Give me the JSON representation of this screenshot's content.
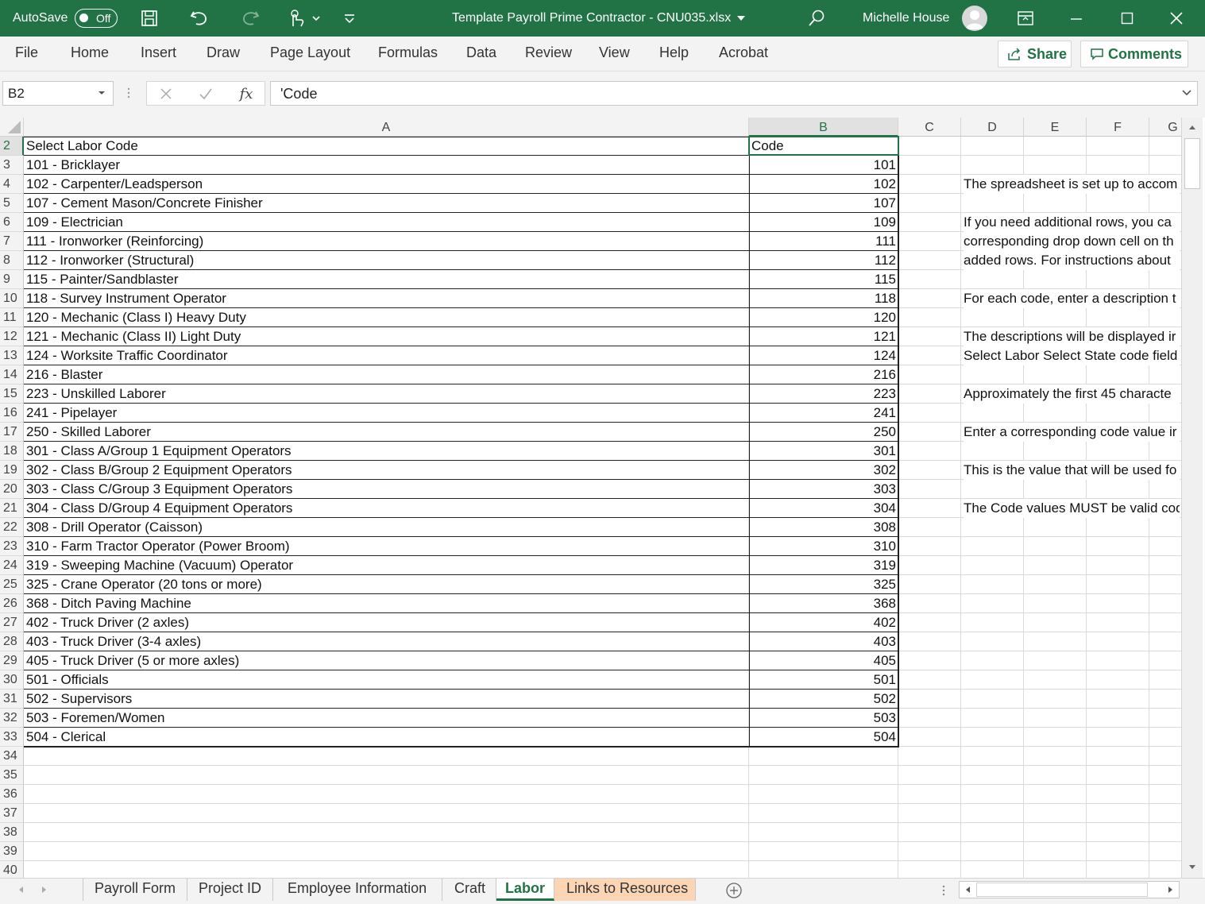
{
  "titlebar": {
    "autosave_label": "AutoSave",
    "autosave_state": "Off",
    "document_title": "Template Payroll Prime Contractor - CNU035.xlsx",
    "user_name": "Michelle House"
  },
  "ribbon": {
    "tabs": [
      "File",
      "Home",
      "Insert",
      "Draw",
      "Page Layout",
      "Formulas",
      "Data",
      "Review",
      "View",
      "Help",
      "Acrobat"
    ],
    "share_label": "Share",
    "comments_label": "Comments"
  },
  "formula_bar": {
    "name_box": "B2",
    "fx_label": "fx",
    "content": "'Code"
  },
  "grid": {
    "columns": [
      "A",
      "B",
      "C",
      "D",
      "E",
      "F",
      "G"
    ],
    "rows": [
      "2",
      "3",
      "4",
      "5",
      "6",
      "7",
      "8",
      "9",
      "10",
      "11",
      "12",
      "13",
      "14",
      "15",
      "16",
      "17",
      "18",
      "19",
      "20",
      "21",
      "22",
      "23",
      "24",
      "25",
      "26",
      "27",
      "28",
      "29",
      "30",
      "31",
      "32",
      "33",
      "34",
      "35",
      "36",
      "37",
      "38",
      "39",
      "40"
    ],
    "header_a": "Select Labor Code",
    "header_b": "Code",
    "labor_rows": [
      {
        "desc": "101 - Bricklayer",
        "code": "101"
      },
      {
        "desc": "102 - Carpenter/Leadsperson",
        "code": "102"
      },
      {
        "desc": "107 - Cement Mason/Concrete Finisher",
        "code": "107"
      },
      {
        "desc": "109 - Electrician",
        "code": "109"
      },
      {
        "desc": "111 - Ironworker (Reinforcing)",
        "code": "111"
      },
      {
        "desc": "112 - Ironworker (Structural)",
        "code": "112"
      },
      {
        "desc": "115 - Painter/Sandblaster",
        "code": "115"
      },
      {
        "desc": "118 - Survey Instrument Operator",
        "code": "118"
      },
      {
        "desc": "120 - Mechanic (Class I) Heavy Duty",
        "code": "120"
      },
      {
        "desc": "121 - Mechanic (Class II) Light Duty",
        "code": "121"
      },
      {
        "desc": "124 - Worksite Traffic Coordinator",
        "code": "124"
      },
      {
        "desc": "216 - Blaster",
        "code": "216"
      },
      {
        "desc": "223 - Unskilled Laborer",
        "code": "223"
      },
      {
        "desc": "241 - Pipelayer",
        "code": "241"
      },
      {
        "desc": "250 - Skilled Laborer",
        "code": "250"
      },
      {
        "desc": "301 - Class A/Group 1 Equipment Operators",
        "code": "301"
      },
      {
        "desc": "302 - Class B/Group 2 Equipment Operators",
        "code": "302"
      },
      {
        "desc": "303 - Class C/Group 3 Equipment Operators",
        "code": "303"
      },
      {
        "desc": "304 - Class D/Group 4 Equipment Operators",
        "code": "304"
      },
      {
        "desc": "308 - Drill Operator (Caisson)",
        "code": "308"
      },
      {
        "desc": "310 - Farm Tractor Operator (Power Broom)",
        "code": "310"
      },
      {
        "desc": "319 - Sweeping Machine (Vacuum) Operator",
        "code": "319"
      },
      {
        "desc": "325 - Crane Operator (20 tons or more)",
        "code": "325"
      },
      {
        "desc": "368 - Ditch Paving Machine",
        "code": "368"
      },
      {
        "desc": "402 - Truck Driver (2 axles)",
        "code": "402"
      },
      {
        "desc": "403 - Truck Driver (3-4 axles)",
        "code": "403"
      },
      {
        "desc": "405 - Truck Driver (5 or more axles)",
        "code": "405"
      },
      {
        "desc": "501 - Officials",
        "code": "501"
      },
      {
        "desc": "502 - Supervisors",
        "code": "502"
      },
      {
        "desc": "503 - Foremen/Women",
        "code": "503"
      },
      {
        "desc": "504 - Clerical",
        "code": "504"
      }
    ],
    "notes": [
      {
        "row": "4",
        "text": "The spreadsheet is set up to accom"
      },
      {
        "row": "6",
        "text": "If you need additional rows, you ca"
      },
      {
        "row": "7",
        "text": "corresponding drop down cell on th"
      },
      {
        "row": "8",
        "text": "added rows. For instructions about"
      },
      {
        "row": "10",
        "text": "For each code, enter a description t"
      },
      {
        "row": "12",
        "text": "The descriptions will be displayed ir"
      },
      {
        "row": "13",
        "text": "Select Labor  Select State code field"
      },
      {
        "row": "15",
        "text": "Approximately the first 45 characte"
      },
      {
        "row": "17",
        "text": "Enter a corresponding code value ir"
      },
      {
        "row": "19",
        "text": "This is the value that will be used fo"
      },
      {
        "row": "21",
        "text": "The Code values MUST be valid cod"
      }
    ]
  },
  "sheet_tabs": [
    "Payroll Form",
    "Project ID",
    "Employee Information",
    "Craft",
    "Labor",
    "Links to Resources"
  ],
  "active_sheet": "Labor",
  "colors": {
    "excel_green": "#217346",
    "tab_highlight": "#fcd5b4"
  }
}
